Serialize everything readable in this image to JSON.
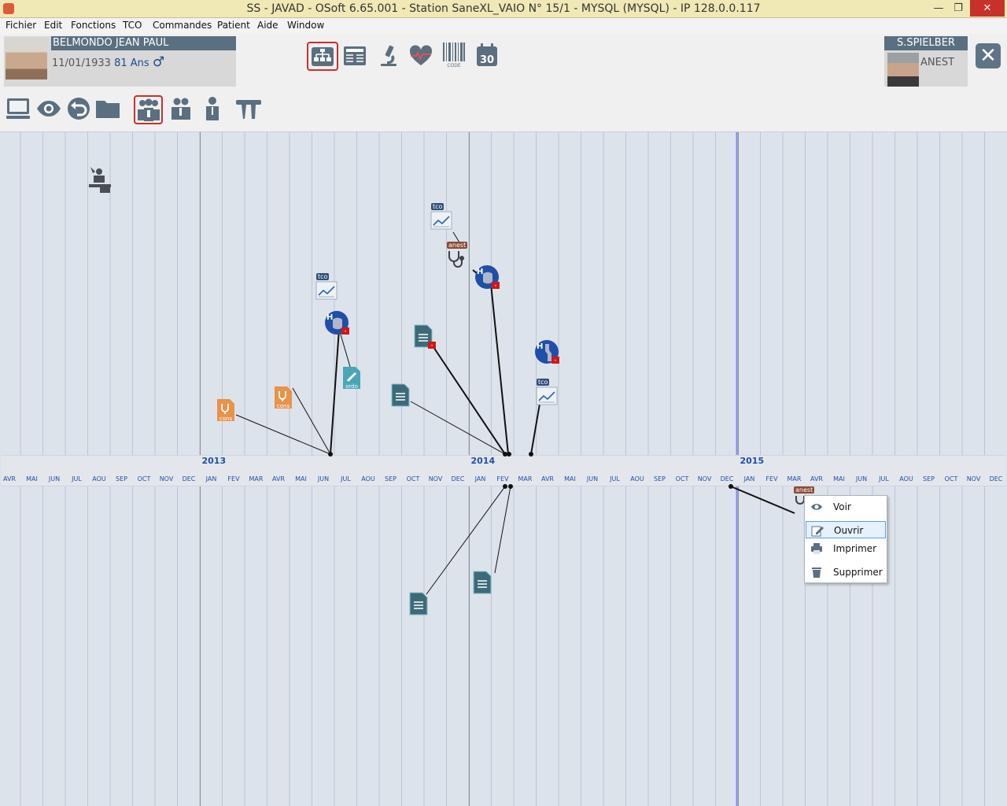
{
  "window": {
    "title": "SS - JAVAD - OSoft 6.65.001 - Station SaneXL_VAIO N° 15/1 - MYSQL (MYSQL) - IP 128.0.0.117",
    "controls": [
      "—",
      "❐",
      "✕"
    ]
  },
  "menu": [
    "Fichier",
    "Edit",
    "Fonctions",
    "TCO",
    "Commandes",
    "Patient",
    "Aide",
    "Window"
  ],
  "patient": {
    "name": "BELMONDO  JEAN PAUL",
    "birthdate": "11/01/1933",
    "age": "81 Ans",
    "sex_symbol": "♂"
  },
  "user": {
    "name": "S.SPIELBER",
    "role": "ANEST"
  },
  "toolbar_top": [
    {
      "name": "structure-view",
      "icon": "org-chart-icon",
      "selected": true
    },
    {
      "name": "record-list",
      "icon": "newspaper-icon",
      "selected": false
    },
    {
      "name": "lab",
      "icon": "microscope-icon",
      "selected": false
    },
    {
      "name": "cardio",
      "icon": "heart-ecg-icon",
      "selected": false
    },
    {
      "name": "barcode",
      "icon": "barcode-icon",
      "label": "CODE",
      "selected": false
    },
    {
      "name": "calendar",
      "icon": "calendar-icon",
      "label": "30",
      "selected": false
    }
  ],
  "toolbar_second": [
    {
      "name": "monitor",
      "icon": "monitor-icon",
      "selected": false
    },
    {
      "name": "view",
      "icon": "eye-icon",
      "selected": false
    },
    {
      "name": "back",
      "icon": "undo-icon",
      "selected": false
    },
    {
      "name": "folder",
      "icon": "folder-icon",
      "selected": false
    },
    {
      "name": "group",
      "icon": "group-icon",
      "selected": true
    },
    {
      "name": "pair",
      "icon": "pair-icon",
      "selected": false
    },
    {
      "name": "person",
      "icon": "person-icon",
      "selected": false
    },
    {
      "name": "tools",
      "icon": "tools-icon",
      "selected": false
    }
  ],
  "timeline": {
    "years": [
      "2013",
      "2014",
      "2015"
    ],
    "months": [
      "AVR",
      "MAI",
      "JUN",
      "JUL",
      "AOU",
      "SEP",
      "OCT",
      "NOV",
      "DEC",
      "JAN",
      "FEV",
      "MAR",
      "AVR",
      "MAI",
      "JUN",
      "JUL",
      "AOU",
      "SEP",
      "OCT",
      "NOV",
      "DEC",
      "JAN",
      "FEV",
      "MAR",
      "AVR",
      "MAI",
      "JUN",
      "JUL",
      "AOU",
      "SEP",
      "OCT",
      "NOV",
      "DEC",
      "JAN",
      "FEV",
      "MAR",
      "AVR",
      "MAI",
      "JUN",
      "JUL",
      "AOU",
      "SEP",
      "OCT",
      "NOV",
      "DEC"
    ],
    "event_labels": {
      "tco": "tco",
      "anest": "anest",
      "cons": "cons",
      "ordo": "ordo",
      "hospital": "H",
      "minus": "-"
    }
  },
  "context_menu": [
    {
      "label": "Voir",
      "icon": "eye-icon",
      "highlighted": false
    },
    {
      "label": "Ouvrir",
      "icon": "edit-icon",
      "highlighted": true
    },
    {
      "label": "Imprimer",
      "icon": "printer-icon",
      "highlighted": false
    },
    {
      "label": "Supprimer",
      "icon": "trash-icon",
      "highlighted": false
    }
  ],
  "colors": {
    "accent": "#1f4fa8",
    "grid_line": "#b9c6d6",
    "year_line": "#8a8f95",
    "today_line": "#7f8ff0",
    "dark_icon": "#5a6f80",
    "selected_border": "#c9302c",
    "cons_orange": "#e8924a",
    "ordo_teal": "#4aa6b6",
    "doc_teal": "#3d6a78",
    "tco_badge": "#2f4f78",
    "anest_badge": "#8a4a34",
    "minus_red": "#d01818"
  }
}
